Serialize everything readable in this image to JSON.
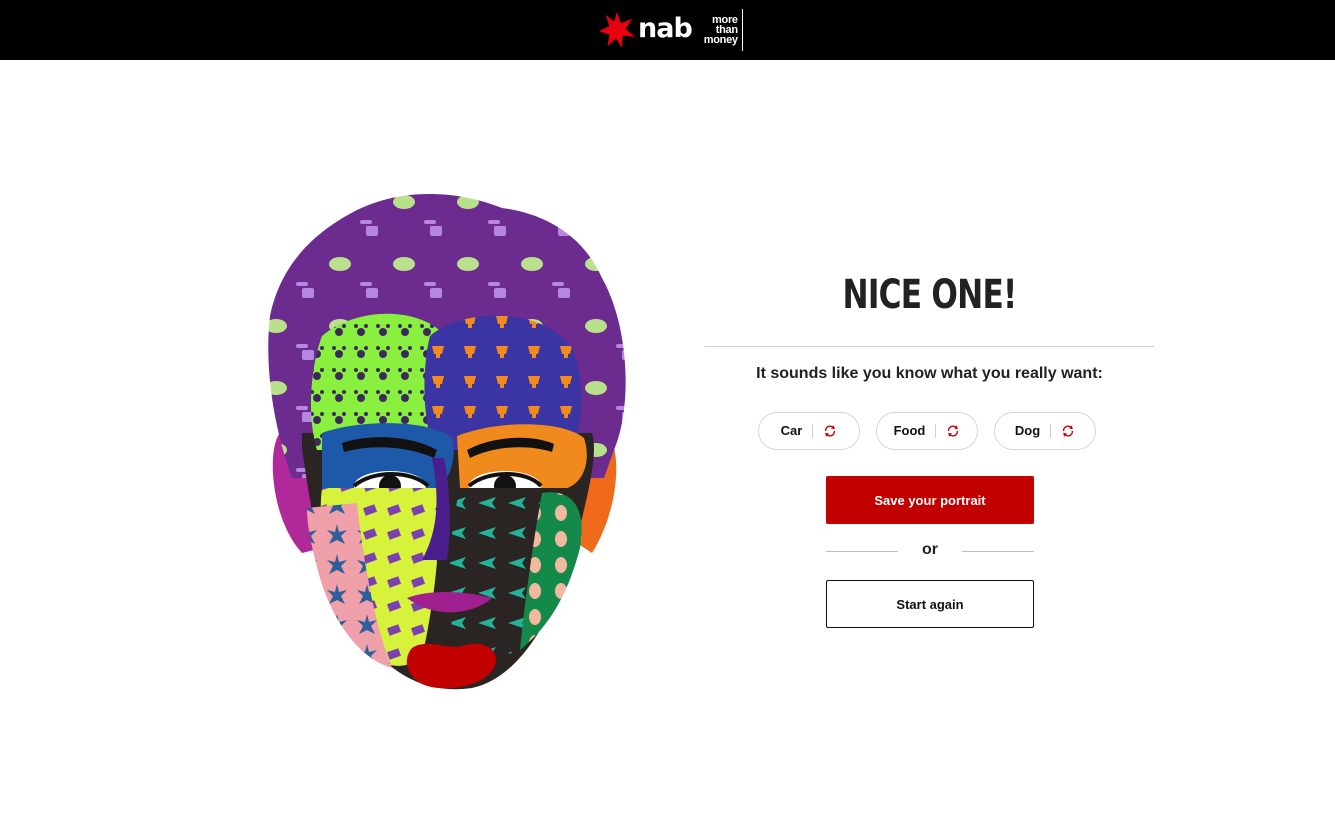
{
  "header": {
    "brand": "nab",
    "tagline": [
      "more",
      "than",
      "money"
    ],
    "logo_icon": "nab-star-icon",
    "background": "#000000",
    "logo_color": "#e8000f"
  },
  "portrait": {
    "icon": "patterned-face-illustration"
  },
  "result": {
    "headline": "NICE ONE!",
    "subtitle": "It sounds like you know what you really want:",
    "wants": [
      {
        "label": "Car",
        "icon": "refresh-icon"
      },
      {
        "label": "Food",
        "icon": "refresh-icon"
      },
      {
        "label": "Dog",
        "icon": "refresh-icon"
      }
    ],
    "save_label": "Save your portrait",
    "or_label": "or",
    "restart_label": "Start again"
  },
  "colors": {
    "accent": "#c20000",
    "text": "#222222",
    "divider": "#cfcfcf"
  }
}
